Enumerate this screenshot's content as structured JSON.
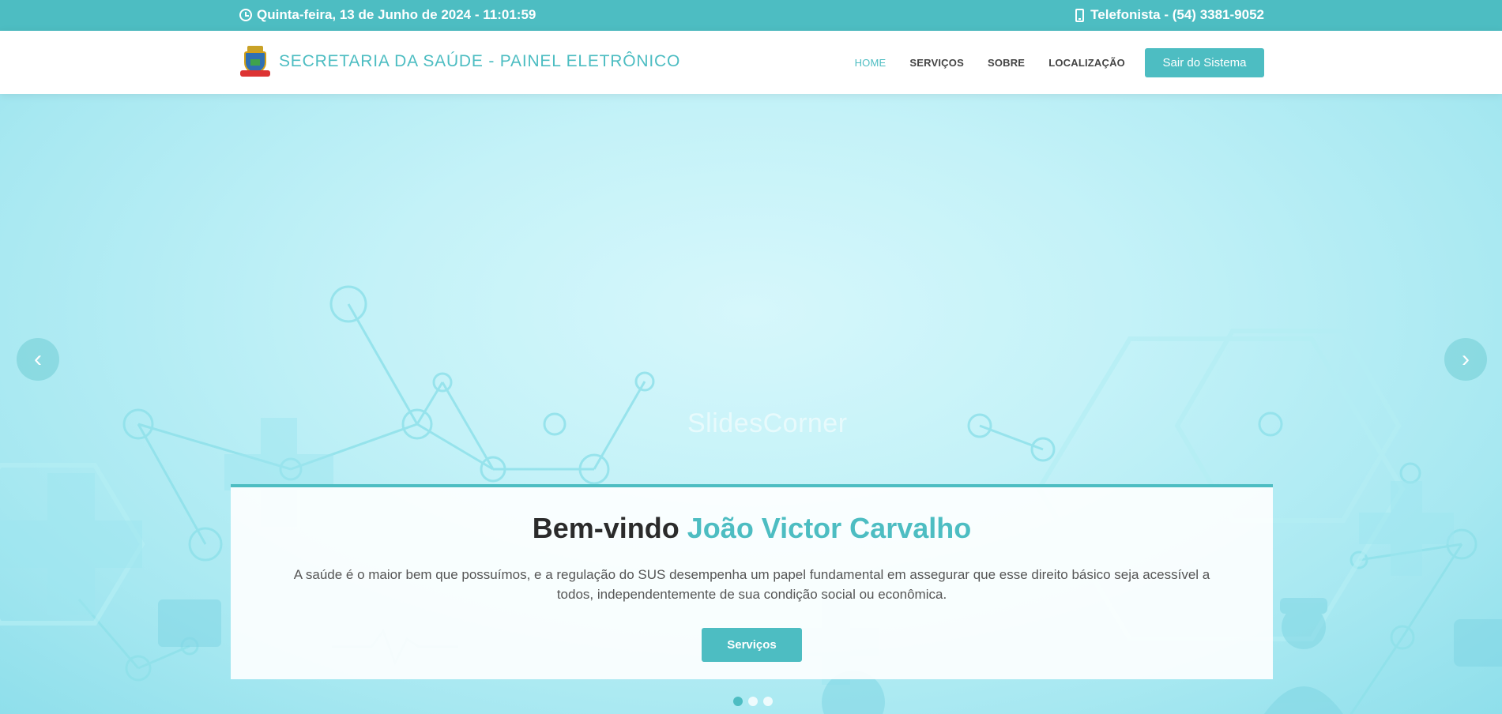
{
  "topbar": {
    "datetime": "Quinta-feira, 13 de Junho de 2024 - 11:01:59",
    "phone": "Telefonista - (54) 3381-9052"
  },
  "header": {
    "title": "SECRETARIA DA SAÚDE - PAINEL ELETRÔNICO",
    "nav": [
      {
        "label": "HOME"
      },
      {
        "label": "SERVIÇOS"
      },
      {
        "label": "SOBRE"
      },
      {
        "label": "LOCALIZAÇÃO"
      }
    ],
    "logout_label": "Sair do Sistema"
  },
  "hero": {
    "watermark": "SlidesCorner",
    "welcome": "Bem-vindo",
    "user_name": "João Victor Carvalho",
    "description": "A saúde é o maior bem que possuímos, e a regulação do SUS desempenha um papel fundamental em assegurar que esse direito básico seja acessível a todos, independentemente de sua condição social ou econômica.",
    "cta_label": "Serviços",
    "prev_glyph": "‹",
    "next_glyph": "›",
    "slides_total": 3,
    "active_slide": 1
  },
  "colors": {
    "accent": "#4dbdc2",
    "text_dark": "#2b2b2b"
  }
}
